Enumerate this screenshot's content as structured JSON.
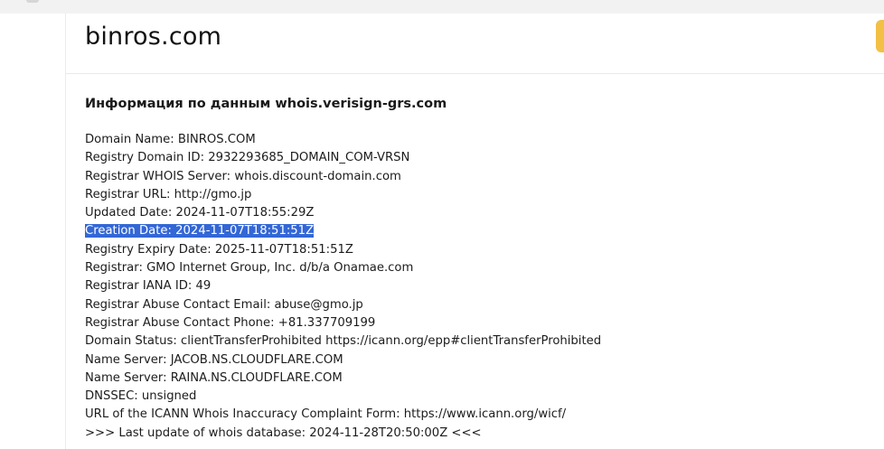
{
  "header": {
    "domain": "binros.com"
  },
  "whois": {
    "title": "Информация по данным whois.verisign-grs.com",
    "lines": [
      "Domain Name: BINROS.COM",
      "Registry Domain ID: 2932293685_DOMAIN_COM-VRSN",
      "Registrar WHOIS Server: whois.discount-domain.com",
      "Registrar URL: http://gmo.jp",
      "Updated Date: 2024-11-07T18:55:29Z",
      "Creation Date: 2024-11-07T18:51:51Z",
      "Registry Expiry Date: 2025-11-07T18:51:51Z",
      "Registrar: GMO Internet Group, Inc. d/b/a Onamae.com",
      "Registrar IANA ID: 49",
      "Registrar Abuse Contact Email: abuse@gmo.jp",
      "Registrar Abuse Contact Phone: +81.337709199",
      "Domain Status: clientTransferProhibited https://icann.org/epp#clientTransferProhibited",
      "Name Server: JACOB.NS.CLOUDFLARE.COM",
      "Name Server: RAINA.NS.CLOUDFLARE.COM",
      "DNSSEC: unsigned",
      "URL of the ICANN Whois Inaccuracy Complaint Form: https://www.icann.org/wicf/",
      ">>> Last update of whois database: 2024-11-28T20:50:00Z <<<"
    ]
  },
  "colors": {
    "selection_highlight": "#3367d6",
    "side_button": "#f2c045"
  }
}
